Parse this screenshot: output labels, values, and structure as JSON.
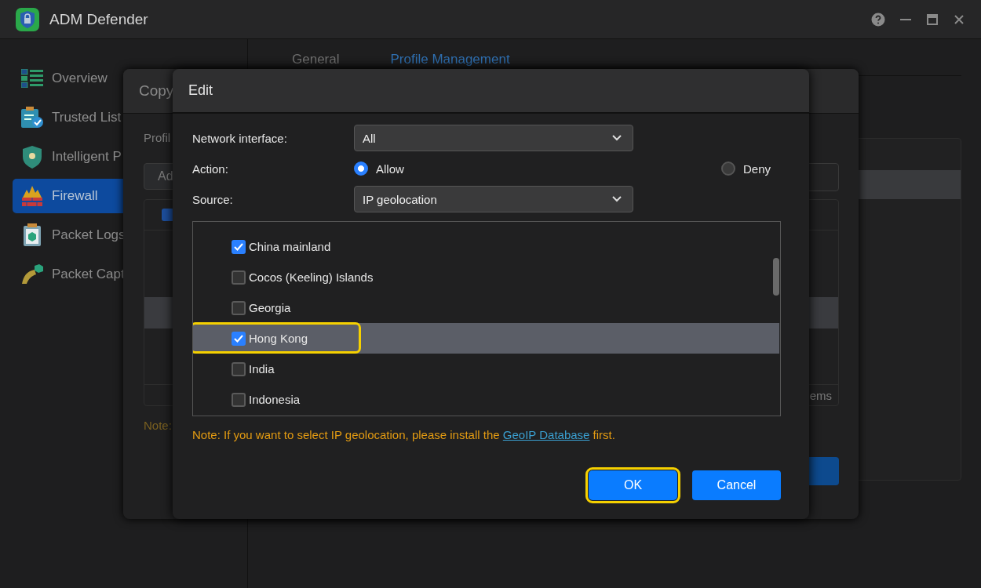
{
  "window": {
    "title": "ADM Defender"
  },
  "sidebar": {
    "items": [
      {
        "label": "Overview",
        "selected": false
      },
      {
        "label": "Trusted List",
        "selected": false
      },
      {
        "label": "Intelligent P",
        "selected": false
      },
      {
        "label": "Firewall",
        "selected": true
      },
      {
        "label": "Packet Logs",
        "selected": false
      },
      {
        "label": "Packet Capt",
        "selected": false
      }
    ]
  },
  "tabs": [
    {
      "label": "General",
      "selected": false
    },
    {
      "label": "Profile Management",
      "selected": true
    }
  ],
  "copy_dialog": {
    "title": "Copy",
    "label": "Profil",
    "button": "Ad",
    "select_all_checked": true,
    "footer": "ems",
    "note": "Note:"
  },
  "edit_dialog": {
    "title": "Edit",
    "fields": [
      {
        "label": "Network interface:",
        "value": "All"
      },
      {
        "label": "Action:"
      },
      {
        "label": "Source:",
        "value": "IP geolocation"
      }
    ],
    "action_options": [
      {
        "label": "Allow",
        "selected": true
      },
      {
        "label": "Deny",
        "selected": false
      }
    ],
    "countries": [
      {
        "label": "China mainland",
        "checked": true,
        "highlighted": false
      },
      {
        "label": "Cocos (Keeling) Islands",
        "checked": false,
        "highlighted": false
      },
      {
        "label": "Georgia",
        "checked": false,
        "highlighted": false
      },
      {
        "label": "Hong Kong",
        "checked": true,
        "highlighted": true
      },
      {
        "label": "India",
        "checked": false,
        "highlighted": false
      },
      {
        "label": "Indonesia",
        "checked": false,
        "highlighted": false
      }
    ],
    "note": {
      "before": "Note: If you want to select IP geolocation, please install the ",
      "link": "GeoIP Database",
      "after": " first."
    },
    "buttons": [
      {
        "label": "OK",
        "highlighted": true
      },
      {
        "label": "Cancel",
        "highlighted": false
      }
    ]
  }
}
